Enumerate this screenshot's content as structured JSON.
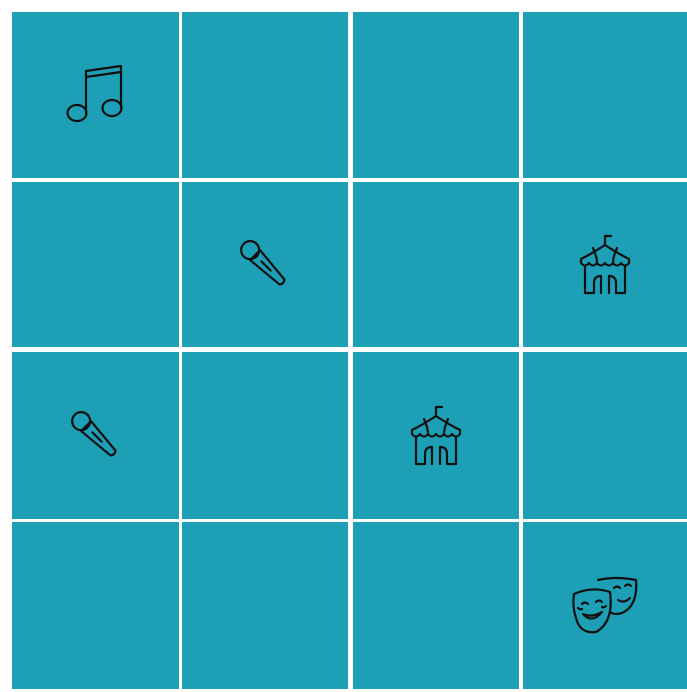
{
  "game": {
    "rows": 4,
    "cols": 4,
    "board_color": "#1d9fb5",
    "line_color": "#ffffff",
    "icon_color": "#111111",
    "cells": [
      [
        "music-note",
        "",
        "",
        ""
      ],
      [
        "",
        "microphone",
        "",
        "circus-tent"
      ],
      [
        "microphone",
        "",
        "circus-tent",
        ""
      ],
      [
        "",
        "",
        "",
        "theater-masks"
      ]
    ]
  }
}
